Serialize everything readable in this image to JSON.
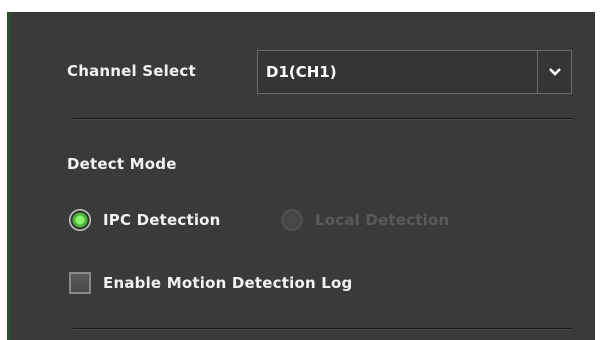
{
  "channel_select": {
    "label": "Channel Select",
    "value": "D1(CH1)",
    "dropdown_icon": "chevron-down-icon"
  },
  "detect_mode": {
    "label": "Detect Mode",
    "options": [
      {
        "label": "IPC Detection",
        "selected": true,
        "enabled": true
      },
      {
        "label": "Local Detection",
        "selected": false,
        "enabled": false
      }
    ]
  },
  "motion_log": {
    "label": "Enable Motion Detection Log",
    "checked": false
  },
  "colors": {
    "panel_bg": "#3a3a3a",
    "accent_green": "#4fb53a",
    "text": "#f2f2f2",
    "disabled_text": "#5a5a5a"
  }
}
